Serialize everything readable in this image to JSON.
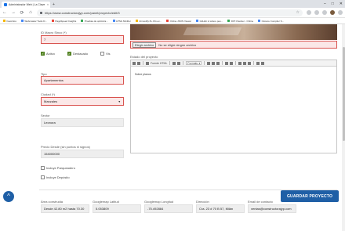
{
  "browser": {
    "tab_title": "Administrador Web | La Clave",
    "tab_close": "×",
    "new_tab": "+",
    "url": "https://www.constructorajyp.com/panel/proyecto/edit/3",
    "back": "←",
    "forward": "→",
    "reload": "⟳",
    "home": "⌂",
    "win_minimize": "–",
    "win_maximize": "□",
    "win_close": "✕",
    "bookmarks": [
      "Favoritos",
      "Webmaster Tools D...",
      "PageSpeed Insights",
      "Pruebas de optimiza...",
      "HTML Minifier",
      "Unmodify.XL.OG ex...",
      "Online JSON Viewer",
      "GitHub is where peo...",
      "DIP Checker - Online",
      "Closure Compiler S..."
    ]
  },
  "form": {
    "id_macro_label": "ID Macro Sinco (*)",
    "id_macro_value": "7",
    "chk_activo": "Activo",
    "chk_destacado": "Destacado",
    "chk_vis": "Vis",
    "tipo_label": "Tipo",
    "tipo_value": "Apartamentos",
    "ciudad_label": "Ciudad (*)",
    "ciudad_value": "Manzales",
    "sector_label": "Sector",
    "sector_value": "Leonora",
    "precio_label": "Precio Desde (sin puntos ni signos)",
    "precio_value": "154000000",
    "chk_parqueadero": "Incluye Parqueadero",
    "chk_deposito": "Incluye Depósito",
    "file_button": "Elegir archivo",
    "file_status": "No se eligió ningún archivo",
    "estado_label": "Estado del proyecto",
    "editor_source": "Fuente HTML",
    "editor_format": "Formato",
    "editor_body": "Sobre planos",
    "area_label": "Área construida",
    "area_value": "Desde 42.80 m2 hasta 70.30",
    "lat_label": "Googlemap Latitud",
    "lat_value": "5.053809",
    "lng_label": "Googlemap Longitud",
    "lng_value": "-75.492884",
    "dir_label": "Dirección",
    "dir_value": "Cra. 23 # 70 B 57, Milán",
    "email_label": "Email de contacto",
    "email_value": "ventas@constructorajyp.com",
    "save_button": "GUARDAR PROYECTO",
    "scroll_up": "^"
  },
  "colors": {
    "primary": "#1f5fa6",
    "error_border": "#d9534f",
    "error_bg": "#fbe7e7",
    "check_on": "#5a8a2a"
  }
}
